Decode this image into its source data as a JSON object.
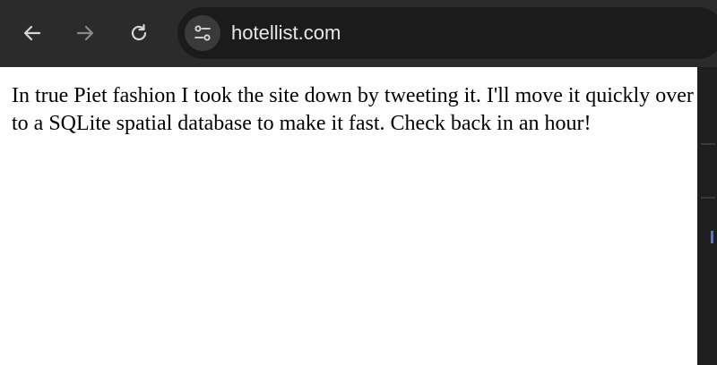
{
  "browser": {
    "url": "hotellist.com",
    "back_icon": "arrow-left-icon",
    "forward_icon": "arrow-right-icon",
    "reload_icon": "reload-icon",
    "site_info_icon": "tune-icon"
  },
  "page": {
    "message": "In true Piet fashion I took the site down by tweeting it. I'll move it quickly over to a SQLite spatial database to make it fast. Check back in an hour!"
  },
  "colors": {
    "toolbar": "#2b2b2b",
    "omnibox": "#1b1b1b",
    "page_background": "#ffffff",
    "text": "#000000"
  }
}
